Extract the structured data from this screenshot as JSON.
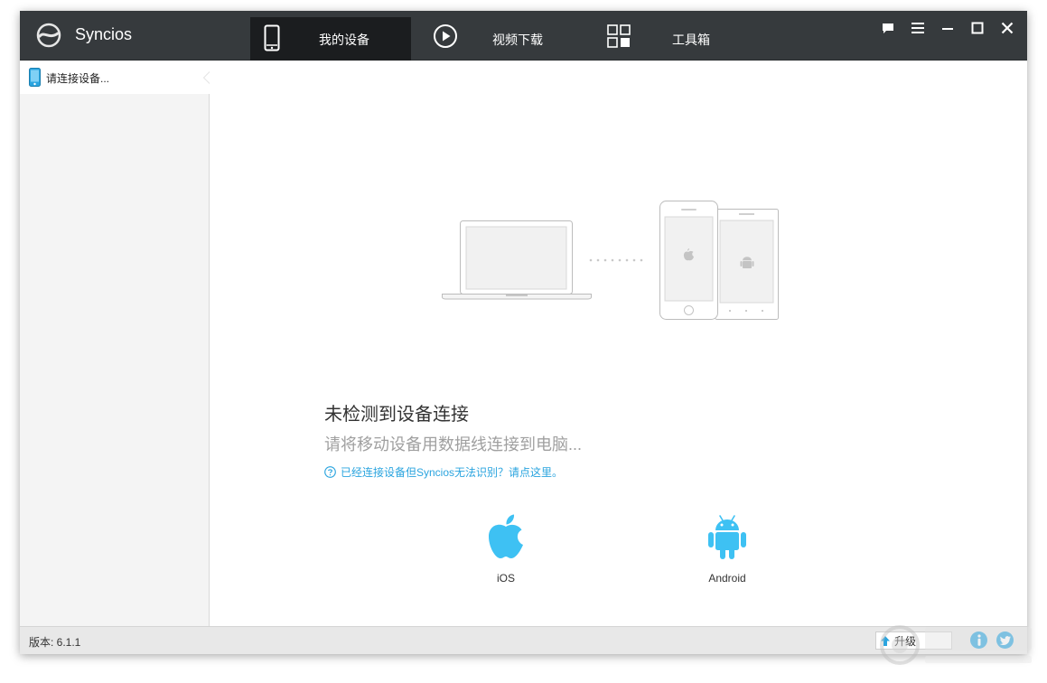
{
  "app": {
    "title": "Syncios"
  },
  "nav": {
    "tabs": [
      {
        "label": "我的设备",
        "icon": "phone-icon",
        "active": true
      },
      {
        "label": "视频下载",
        "icon": "play-icon",
        "active": false
      },
      {
        "label": "工具箱",
        "icon": "grid-icon",
        "active": false
      }
    ]
  },
  "window_controls": [
    "feedback-icon",
    "menu-icon",
    "minimize-icon",
    "maximize-icon",
    "close-icon"
  ],
  "sidebar": {
    "items": [
      {
        "label": "请连接设备...",
        "icon": "device-icon"
      }
    ]
  },
  "main": {
    "headline": "未检测到设备连接",
    "subline": "请将移动设备用数据线连接到电脑...",
    "help_link": "已经连接设备但Syncios无法识别？请点这里。",
    "os_options": [
      {
        "label": "iOS",
        "icon": "apple-icon"
      },
      {
        "label": "Android",
        "icon": "android-icon"
      }
    ]
  },
  "statusbar": {
    "version": "版本: 6.1.1",
    "upgrade_label": "升级"
  },
  "colors": {
    "titlebar": "#363a3d",
    "active_tab": "#1b1d1f",
    "accent": "#2aa4df",
    "os_icon": "#3ec1f3"
  }
}
